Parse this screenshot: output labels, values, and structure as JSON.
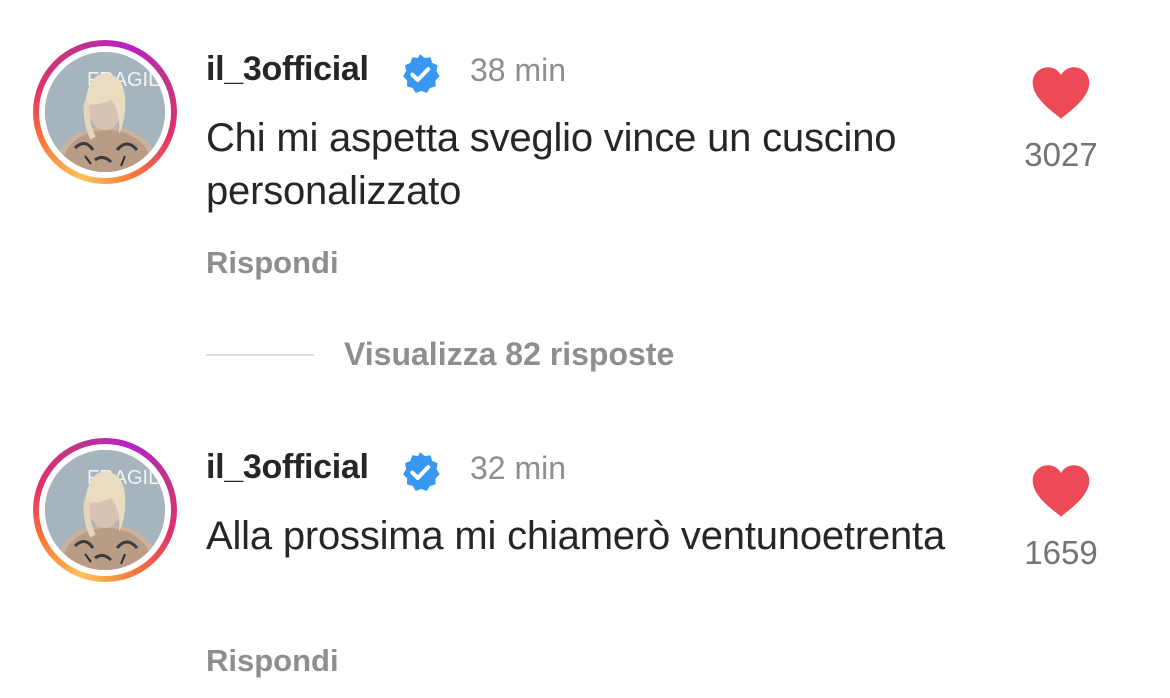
{
  "colors": {
    "like": "#ed4956",
    "verified": "#3897f0",
    "muted_text": "#8e8e8e",
    "primary_text": "#262626"
  },
  "comments": [
    {
      "avatar_text": "FRAGILI",
      "username": "il_3official",
      "verified_icon": "verified-badge-icon",
      "time": "38 min",
      "text": "Chi mi aspetta sveglio vince un cuscino personalizzato",
      "reply_label": "Rispondi",
      "like_icon": "heart-filled-icon",
      "like_count": "3027"
    },
    {
      "avatar_text": "FRAGILI",
      "username": "il_3official",
      "verified_icon": "verified-badge-icon",
      "time": "32 min",
      "text": "Alla prossima mi chiamerò ventunoetrenta",
      "reply_label": "Rispondi",
      "like_icon": "heart-filled-icon",
      "like_count": "1659"
    }
  ],
  "view_replies": {
    "label": "Visualizza 82 risposte"
  }
}
